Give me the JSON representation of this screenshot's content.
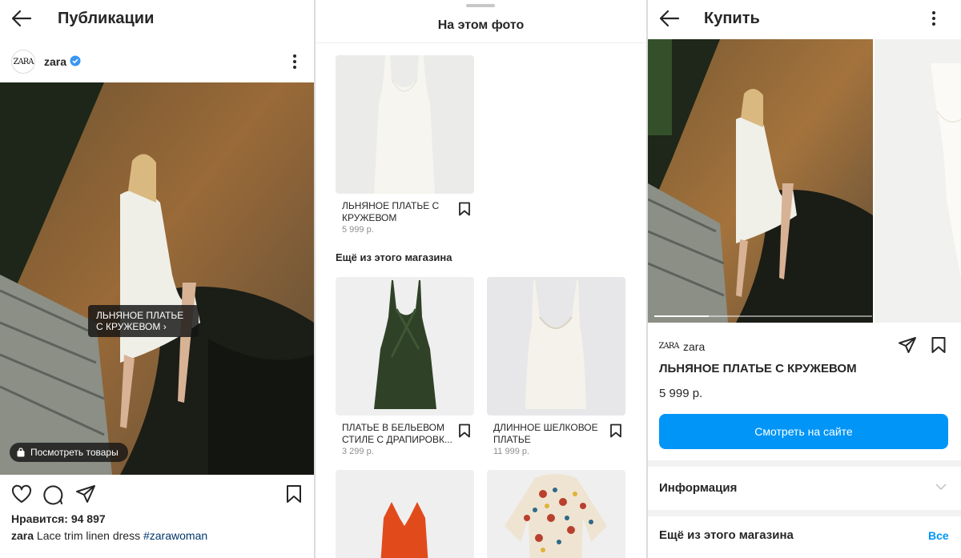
{
  "panel1": {
    "title": "Публикации",
    "username": "zara",
    "logo_text": "ZARA",
    "tag_label": "ЛЬНЯНОЕ ПЛАТЬЕ С КРУЖЕВОМ",
    "view_products": "Посмотреть товары",
    "likes": "Нравится: 94 897",
    "caption_user": "zara",
    "caption_text": " Lace trim linen dress ",
    "caption_hashtag": "#zarawoman"
  },
  "panel2": {
    "title": "На этом фото",
    "tagged_product": {
      "name": "ЛЬНЯНОЕ ПЛАТЬЕ С КРУЖЕВОМ",
      "price": "5 999 р."
    },
    "more_label": "Ещё из этого магазина",
    "more_products": [
      {
        "name": "ПЛАТЬЕ В БЕЛЬЕВОМ СТИЛЕ С ДРАПИРОВК...",
        "price": "3 299 р."
      },
      {
        "name": "ДЛИННОЕ ШЕЛКОВОЕ ПЛАТЬЕ",
        "price": "11 999 р."
      }
    ]
  },
  "panel3": {
    "title": "Купить",
    "brand": "zara",
    "logo_text": "ZARA",
    "product_name": "ЛЬНЯНОЕ ПЛАТЬЕ С КРУЖЕВОМ",
    "price": "5 999 р.",
    "cta": "Смотреть на сайте",
    "info_label": "Информация",
    "more_label": "Ещё из этого магазина",
    "see_all": "Все"
  },
  "colors": {
    "accent": "#0095f6",
    "verified": "#3897f0",
    "text": "#262626",
    "muted": "#8e8e8e"
  }
}
